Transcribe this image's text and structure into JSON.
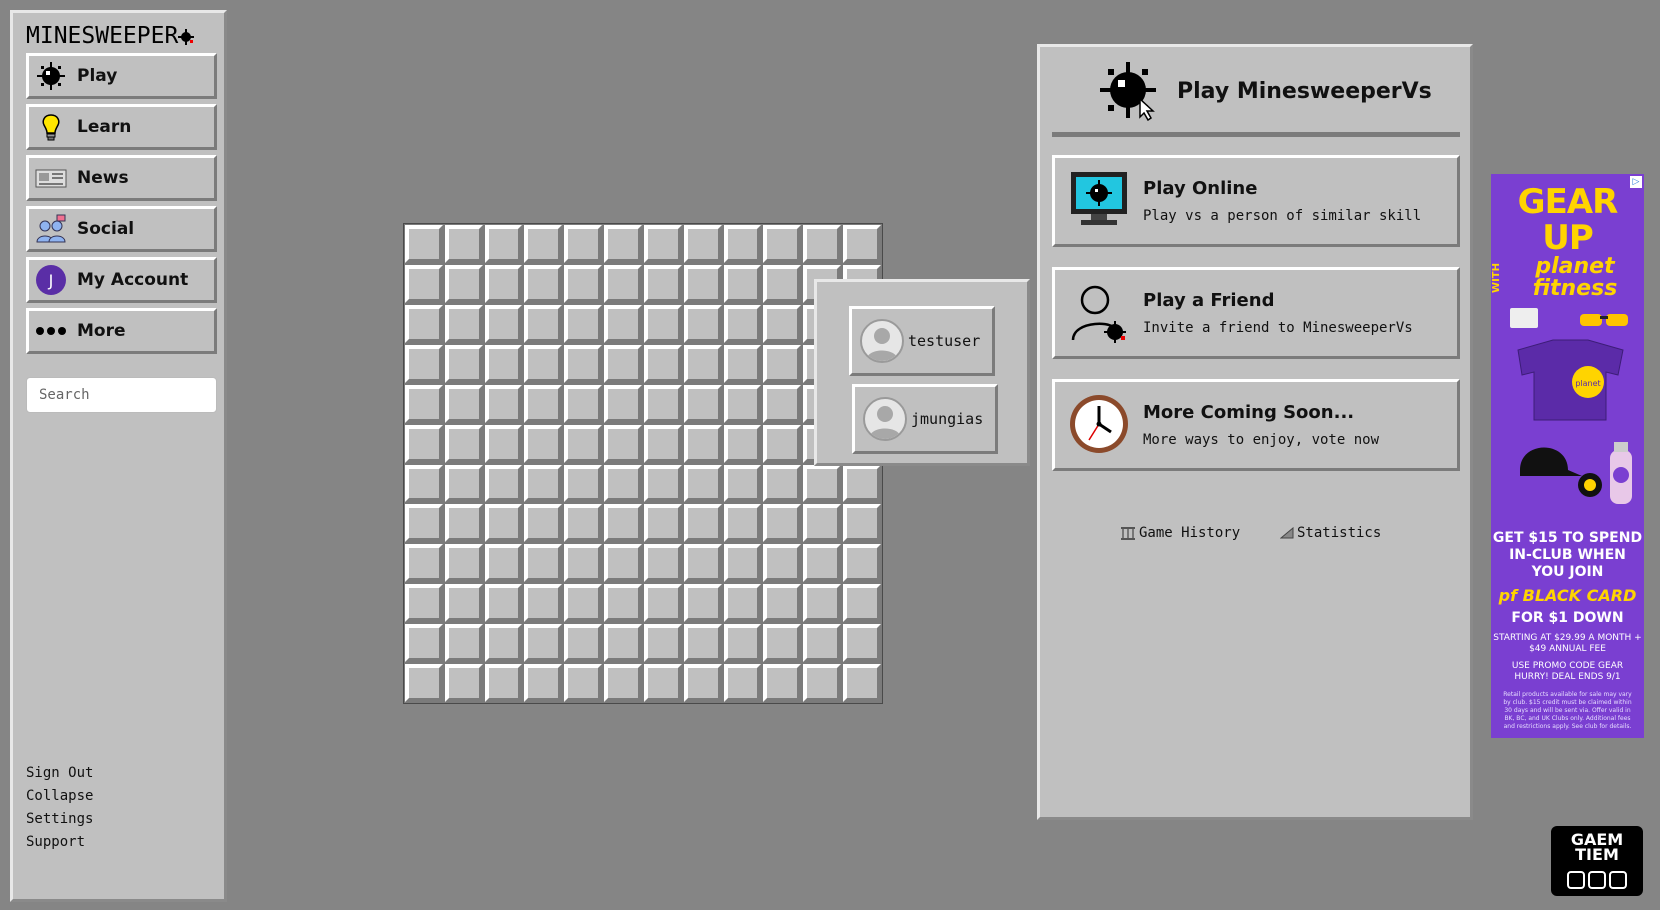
{
  "sidebar": {
    "logo": "MINESWEEPER",
    "nav": [
      {
        "label": "Play",
        "icon": "mine-icon"
      },
      {
        "label": "Learn",
        "icon": "lightbulb-icon"
      },
      {
        "label": "News",
        "icon": "newspaper-icon"
      },
      {
        "label": "Social",
        "icon": "people-icon"
      },
      {
        "label": "My Account",
        "icon": "avatar-icon",
        "avatar_letter": "J"
      },
      {
        "label": "More",
        "icon": "dots-icon"
      }
    ],
    "search_placeholder": "Search",
    "footer": [
      "Sign Out",
      "Collapse",
      "Settings",
      "Support"
    ]
  },
  "board": {
    "rows": 12,
    "cols": 12
  },
  "players": [
    {
      "name": "testuser"
    },
    {
      "name": "jmungias"
    }
  ],
  "vs_panel": {
    "title": "Play MinesweeperVs",
    "options": [
      {
        "title": "Play Online",
        "subtitle": "Play vs a person of similar skill",
        "icon": "monitor-mine-icon"
      },
      {
        "title": "Play a Friend",
        "subtitle": "Invite a friend to MinesweeperVs",
        "icon": "friend-icon"
      },
      {
        "title": "More Coming Soon...",
        "subtitle": "More ways to enjoy, vote now",
        "icon": "clock-icon"
      }
    ],
    "links": [
      {
        "label": "Game History",
        "icon": "history-icon"
      },
      {
        "label": "Statistics",
        "icon": "chart-icon"
      }
    ]
  },
  "ad": {
    "headline": "GEAR UP",
    "with": "WITH",
    "brand": "planet fitness",
    "copy1": "GET $15 TO SPEND IN-CLUB WHEN YOU JOIN",
    "card": "pf BLACK CARD",
    "price": "FOR $1 DOWN",
    "starting": "STARTING AT $29.99 A MONTH + $49 ANNUAL FEE",
    "promo": "USE PROMO CODE GEAR",
    "deal": "HURRY! DEAL ENDS 9/1",
    "fine": "Retail products available for sale may vary by club. $15 credit must be claimed within 30 days and will be sent via. Offer valid in BK, BC, and UK Clubs only. Additional fees and restrictions apply. See club for details."
  },
  "badge": {
    "line1": "GAEM",
    "line2": "TIEM"
  },
  "colors": {
    "background": "#858585",
    "panel": "#c0c0c0",
    "ad_bg": "#7a3fd1",
    "ad_yellow": "#ffd400"
  }
}
